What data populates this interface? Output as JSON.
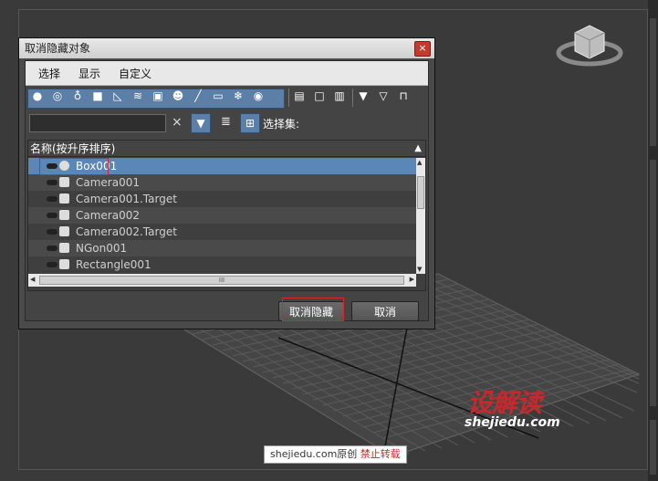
{
  "dialog": {
    "title": "取消隐藏对象",
    "close_glyph": "×",
    "menu": [
      "选择",
      "显示",
      "自定义"
    ],
    "search": {
      "value": "",
      "placeholder": ""
    },
    "clear_glyph": "×",
    "selection_set_label": "选择集:",
    "list_header": "名称(按升序排序)",
    "sort_glyph": "▲",
    "items": [
      {
        "name": "Box001",
        "icon": "sphere-icon",
        "selected": true
      },
      {
        "name": "Camera001",
        "icon": "camera-icon",
        "selected": false
      },
      {
        "name": "Camera001.Target",
        "icon": "camera-icon",
        "selected": false
      },
      {
        "name": "Camera002",
        "icon": "camera-icon",
        "selected": false
      },
      {
        "name": "Camera002.Target",
        "icon": "camera-icon",
        "selected": false
      },
      {
        "name": "NGon001",
        "icon": "shape-icon",
        "selected": false
      },
      {
        "name": "Rectangle001",
        "icon": "shape-icon",
        "selected": false
      }
    ],
    "hscroll_glyph": "III",
    "buttons": {
      "unhide": "取消隐藏",
      "cancel": "取消"
    }
  },
  "watermark": {
    "cn": "设解读",
    "en": "shejiedu.com"
  },
  "footer": {
    "prefix": "shejiedu.com原创",
    "suffix": "禁止转载"
  }
}
